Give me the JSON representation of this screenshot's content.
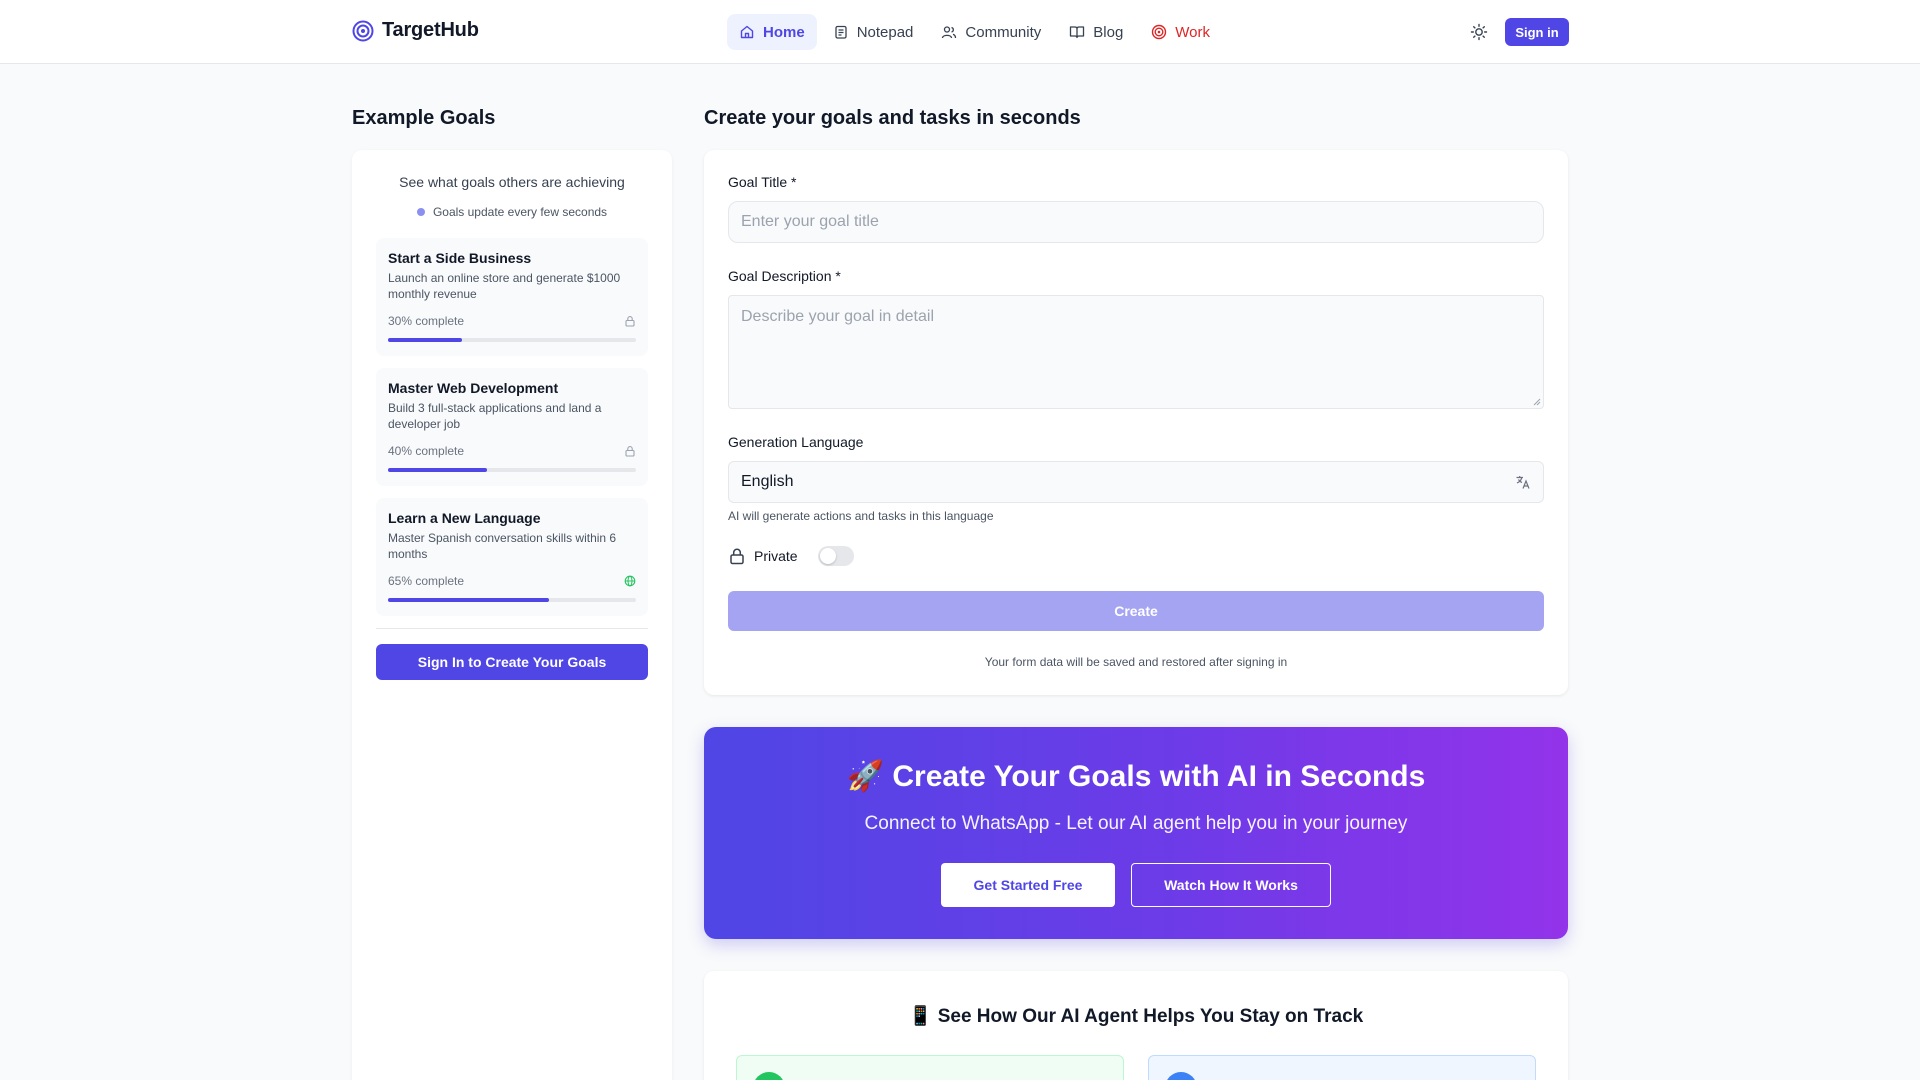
{
  "app": {
    "name": "TargetHub"
  },
  "nav": [
    {
      "label": "Home",
      "icon": "home-icon",
      "active": true
    },
    {
      "label": "Notepad",
      "icon": "notepad-icon"
    },
    {
      "label": "Community",
      "icon": "users-icon"
    },
    {
      "label": "Blog",
      "icon": "book-icon"
    },
    {
      "label": "Work",
      "icon": "target-icon",
      "color": "#dc2626"
    }
  ],
  "header": {
    "signin_label": "Sign in",
    "theme_icon": "sun-icon"
  },
  "left": {
    "title": "Example Goals",
    "subtitle": "See what goals others are achieving",
    "note": "Goals update every few seconds",
    "goals": [
      {
        "title": "Start a Side Business",
        "description": "Launch an online store and generate $1000 monthly revenue",
        "progress_label": "30% complete",
        "progress": 0.3,
        "visibility_icon": "lock-icon"
      },
      {
        "title": "Master Web Development",
        "description": "Build 3 full-stack applications and land a developer job",
        "progress_label": "40% complete",
        "progress": 0.4,
        "visibility_icon": "lock-icon"
      },
      {
        "title": "Learn a New Language",
        "description": "Master Spanish conversation skills within 6 months",
        "progress_label": "65% complete",
        "progress": 0.65,
        "visibility_icon": "globe-icon"
      }
    ],
    "cta_label": "Sign In to Create Your Goals"
  },
  "form": {
    "title": "Create your goals and tasks in seconds",
    "goal_title_label": "Goal Title *",
    "goal_title_placeholder": "Enter your goal title",
    "goal_description_label": "Goal Description *",
    "goal_description_placeholder": "Describe your goal in detail",
    "language_label": "Generation Language",
    "language_value": "English",
    "language_hint": "AI will generate actions and tasks in this language",
    "private_label": "Private",
    "private_enabled": false,
    "create_label": "Create",
    "save_note": "Your form data will be saved and restored after signing in"
  },
  "promo": {
    "title": "🚀 Create Your Goals with AI in Seconds",
    "subtitle": "Connect to WhatsApp - Let our AI agent help you in your journey",
    "primary_label": "Get Started Free",
    "secondary_label": "Watch How It Works"
  },
  "how": {
    "title": "📱 See How Our AI Agent Helps You Stay on Track"
  },
  "colors": {
    "accent": "#4f46e5",
    "work": "#dc2626",
    "success": "#22c55e",
    "info": "#3b82f6"
  }
}
